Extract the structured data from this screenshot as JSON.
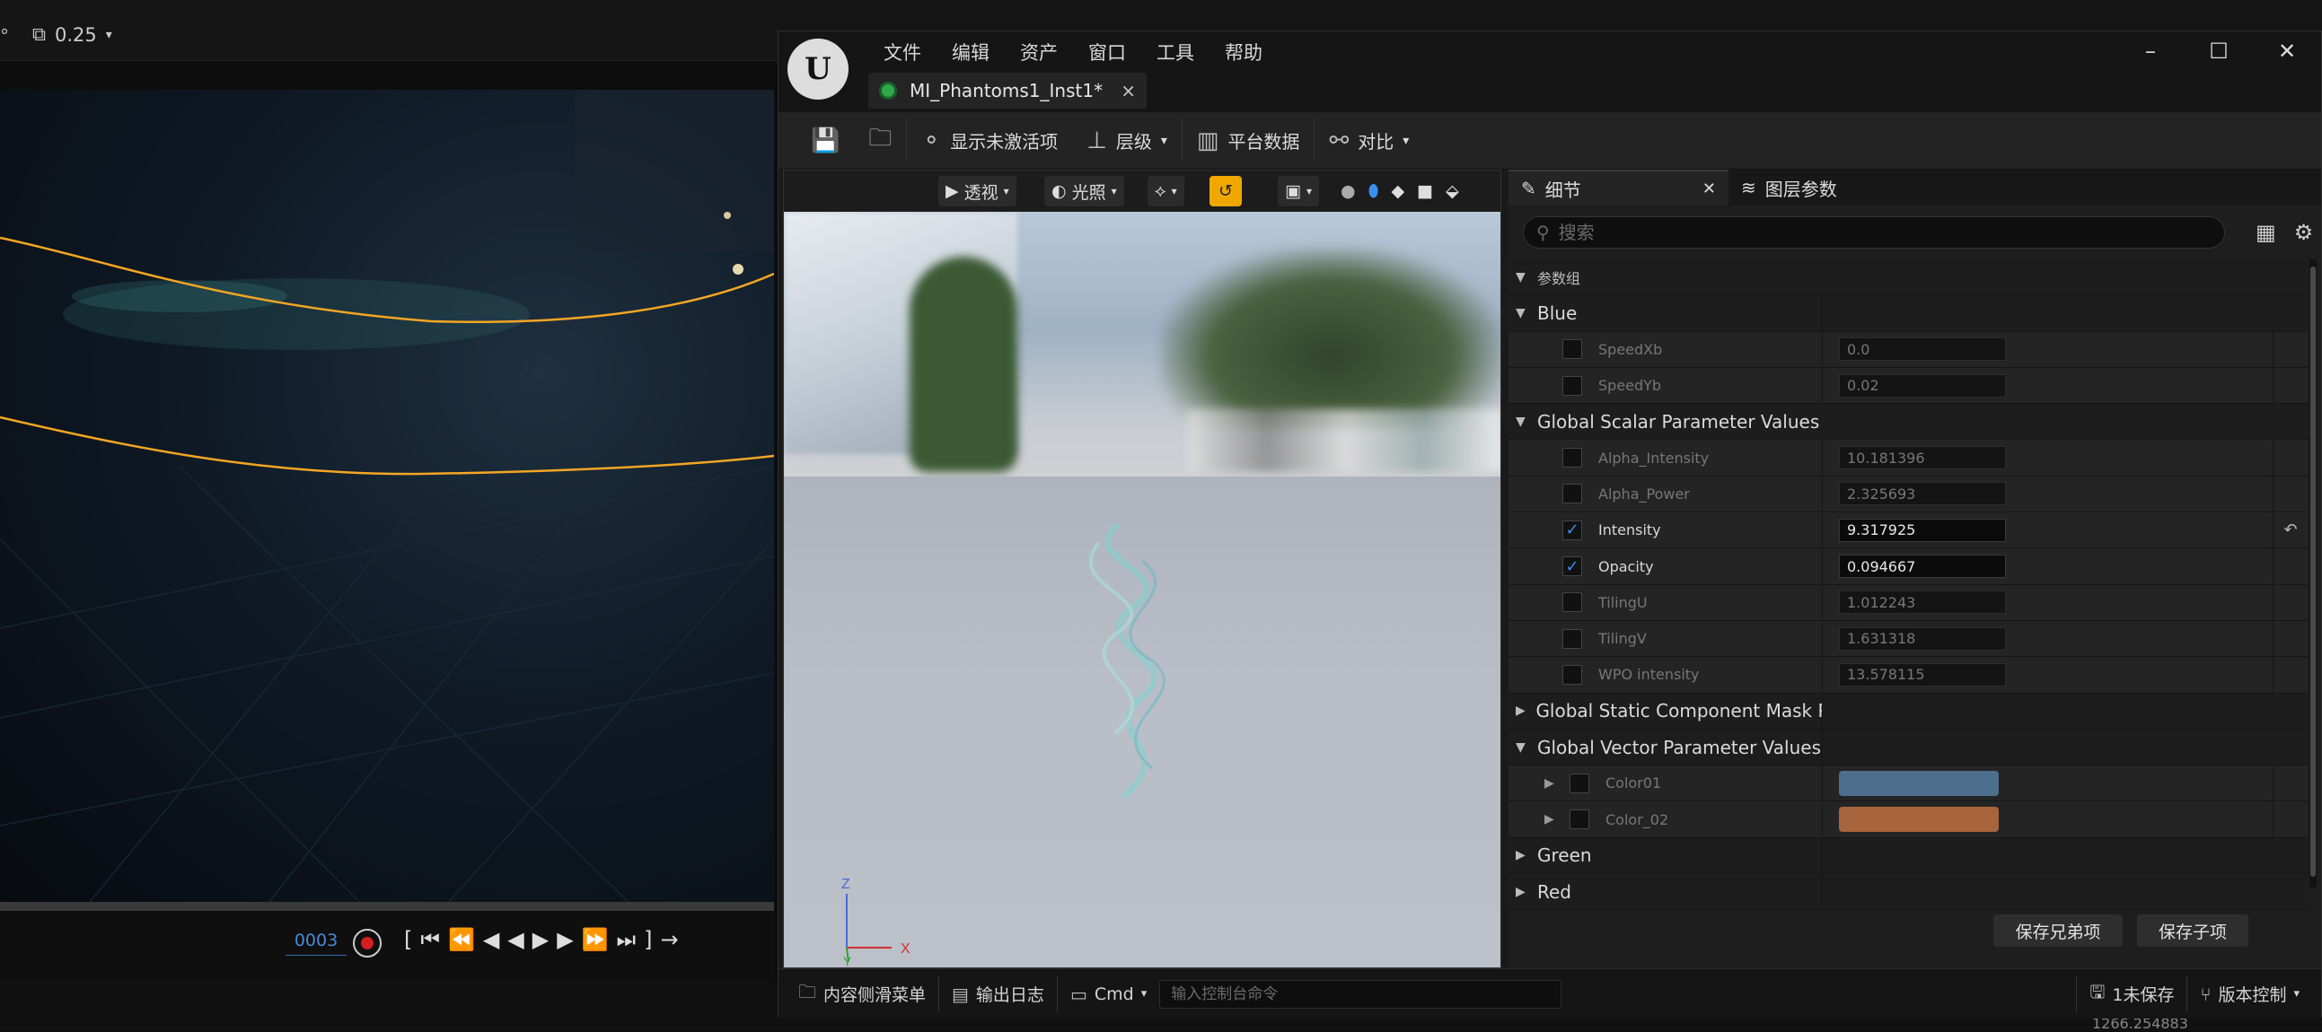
{
  "background": {
    "degree_symbol": "°",
    "snap_value": "0.25",
    "current_frame": "0003",
    "coordinate_readout": "1266.254883"
  },
  "window": {
    "logo": "U",
    "menus": [
      "文件",
      "编辑",
      "资产",
      "窗口",
      "工具",
      "帮助"
    ],
    "controls": [
      "minimize-icon",
      "maximize-icon",
      "close-icon"
    ],
    "tab": {
      "name": "MI_Phantoms1_Inst1*",
      "close": "×"
    }
  },
  "toolbar": {
    "show_inactive": "显示未激活项",
    "hierarchy": "层级",
    "platform_stats": "平台数据",
    "compare": "对比"
  },
  "viewport": {
    "perspective": "透视",
    "lighting": "光照",
    "axis_z": "Z",
    "axis_y": "Y",
    "axis_x": "X"
  },
  "details": {
    "tab_details": "细节",
    "tab_layer_params": "图层参数",
    "search_placeholder": "搜索",
    "param_groups_label": "参数组",
    "categories": {
      "blue": "Blue",
      "global_scalar": "Global Scalar Parameter Values",
      "global_static": "Global Static Component Mask Par",
      "global_vector": "Global Vector Parameter Values",
      "green": "Green",
      "red": "Red"
    },
    "blue_params": [
      {
        "name": "SpeedXb",
        "value": "0.0",
        "enabled": false
      },
      {
        "name": "SpeedYb",
        "value": "0.02",
        "enabled": false
      }
    ],
    "scalar_params": [
      {
        "name": "Alpha_Intensity",
        "value": "10.181396",
        "enabled": false
      },
      {
        "name": "Alpha_Power",
        "value": "2.325693",
        "enabled": false
      },
      {
        "name": "Intensity",
        "value": "9.317925",
        "enabled": true
      },
      {
        "name": "Opacity",
        "value": "0.094667",
        "enabled": true
      },
      {
        "name": "TilingU",
        "value": "1.012243",
        "enabled": false
      },
      {
        "name": "TilingV",
        "value": "1.631318",
        "enabled": false
      },
      {
        "name": "WPO intensity",
        "value": "13.578115",
        "enabled": false
      }
    ],
    "vector_params": [
      {
        "name": "Color01",
        "color": "#4d6f8d"
      },
      {
        "name": "Color_02",
        "color": "#a8643c"
      }
    ],
    "save_sibling": "保存兄弟项",
    "save_child": "保存子项"
  },
  "status": {
    "content_drawer": "内容侧滑菜单",
    "output_log": "输出日志",
    "cmd": "Cmd",
    "console_placeholder": "输入控制台命令",
    "unsaved": "1未保存",
    "source_control": "版本控制"
  },
  "colors": {
    "accent_blue": "#3a8ef0",
    "active_orange": "#f0a800",
    "spline_orange": "#f5a623"
  }
}
